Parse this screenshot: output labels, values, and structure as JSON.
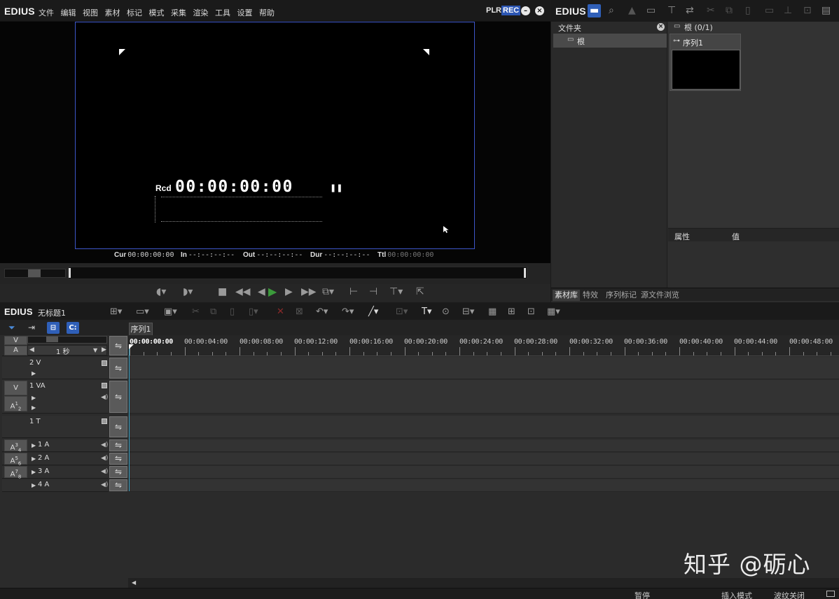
{
  "player": {
    "logo": "EDIUS",
    "menu": [
      "文件",
      "编辑",
      "视图",
      "素材",
      "标记",
      "模式",
      "采集",
      "渲染",
      "工具",
      "设置",
      "帮助"
    ],
    "plr_label": "PLR",
    "rec_label": "REC",
    "timecode_label": "Rcd",
    "timecode": "00:00:00:00",
    "pause_icon": "pause-icon",
    "cur_label": "Cur",
    "cur_value": "00:00:00:00",
    "in_label": "In",
    "in_value": "--:--:--:--",
    "out_label": "Out",
    "out_value": "--:--:--:--",
    "dur_label": "Dur",
    "dur_value": "--:--:--:--",
    "ttl_label": "Ttl",
    "ttl_value": "00:00:00:00"
  },
  "bin": {
    "logo": "EDIUS",
    "folder_header": "文件夹",
    "root_folder": "根",
    "clip_header": "根 (0/1)",
    "clip_name": "序列1",
    "prop_col1": "属性",
    "prop_col2": "值",
    "tabs": [
      "素材库",
      "特效",
      "序列标记",
      "源文件浏览"
    ]
  },
  "timeline": {
    "logo": "EDIUS",
    "project": "无标题1",
    "sequence_tab": "序列1",
    "scale_label": "1 秒",
    "patch_v": "V",
    "patch_a": "A",
    "tracks": {
      "v2": "2 V",
      "va1": "1 VA",
      "va1_patch_v": "V",
      "va1_patch_a": "A",
      "va1_patch_a_sub": "1",
      "va1_patch_a_sub2": "2",
      "t1": "1 T",
      "a1": "1 A",
      "a1_patch": "A",
      "a1_sub": "3",
      "a1_sub2": "4",
      "a2": "2 A",
      "a2_patch": "A",
      "a2_sub": "5",
      "a2_sub2": "6",
      "a3": "3 A",
      "a3_patch": "A",
      "a3_sub": "7",
      "a3_sub2": "8",
      "a4": "4 A"
    },
    "ruler": [
      "00:00:00:00",
      "00:00:04:00",
      "00:00:08:00",
      "00:00:12:00",
      "00:00:16:00",
      "00:00:20:00",
      "00:00:24:00",
      "00:00:28:00",
      "00:00:32:00",
      "00:00:36:00",
      "00:00:40:00",
      "00:00:44:00",
      "00:00:48:00"
    ]
  },
  "status": {
    "pause": "暂停",
    "insert_mode": "插入模式",
    "ripple": "波纹关闭"
  },
  "watermark": "知乎 @砺心"
}
